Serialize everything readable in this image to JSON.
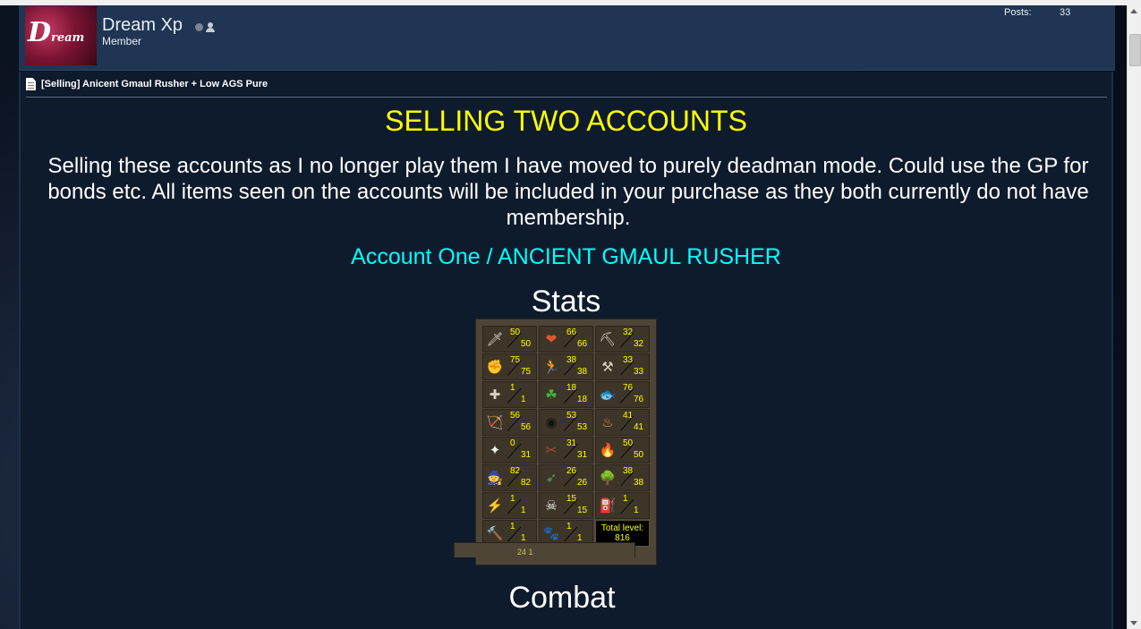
{
  "user": {
    "name": "Dream Xp",
    "title": "Member",
    "posts_label": "Posts:",
    "posts_count": "33",
    "avatar_text_big": "D",
    "avatar_text_small": "ream"
  },
  "post": {
    "title": "[Selling] Anicent Gmaul Rusher + Low AGS Pure",
    "heading": "SELLING TWO ACCOUNTS",
    "intro": "Selling these accounts as I no longer play them I have moved to purely deadman mode. Could use the GP for bonds etc. All items seen on the accounts will be included in your purchase as they both currently do not have membership.",
    "account_heading": "Account One / ANCIENT GMAUL RUSHER",
    "stats_heading": "Stats",
    "combat_heading": "Combat"
  },
  "stats": {
    "skills": [
      {
        "icon": "attack-icon",
        "glyph": "🗡",
        "level": "50",
        "max": "50"
      },
      {
        "icon": "hitpoints-icon",
        "glyph": "❤",
        "level": "66",
        "max": "66"
      },
      {
        "icon": "mining-icon",
        "glyph": "⛏",
        "level": "32",
        "max": "32"
      },
      {
        "icon": "strength-icon",
        "glyph": "✊",
        "level": "75",
        "max": "75"
      },
      {
        "icon": "agility-icon",
        "glyph": "🏃",
        "level": "38",
        "max": "38"
      },
      {
        "icon": "smithing-icon",
        "glyph": "⚒",
        "level": "33",
        "max": "33"
      },
      {
        "icon": "defence-icon",
        "glyph": "✚",
        "level": "1",
        "max": "1"
      },
      {
        "icon": "herblore-icon",
        "glyph": "☘",
        "level": "18",
        "max": "18"
      },
      {
        "icon": "fishing-icon",
        "glyph": "🐟",
        "level": "76",
        "max": "76"
      },
      {
        "icon": "ranged-icon",
        "glyph": "🏹",
        "level": "56",
        "max": "56"
      },
      {
        "icon": "thieving-icon",
        "glyph": "◉",
        "level": "53",
        "max": "53"
      },
      {
        "icon": "cooking-icon",
        "glyph": "♨",
        "level": "41",
        "max": "41"
      },
      {
        "icon": "prayer-icon",
        "glyph": "✦",
        "level": "0",
        "max": "31"
      },
      {
        "icon": "crafting-icon",
        "glyph": "✂",
        "level": "31",
        "max": "31"
      },
      {
        "icon": "firemaking-icon",
        "glyph": "🔥",
        "level": "50",
        "max": "50"
      },
      {
        "icon": "magic-icon",
        "glyph": "🧙",
        "level": "82",
        "max": "82"
      },
      {
        "icon": "fletching-icon",
        "glyph": "➶",
        "level": "26",
        "max": "26"
      },
      {
        "icon": "woodcutting-icon",
        "glyph": "🌳",
        "level": "38",
        "max": "38"
      },
      {
        "icon": "runecraft-icon",
        "glyph": "⚡",
        "level": "1",
        "max": "1"
      },
      {
        "icon": "slayer-icon",
        "glyph": "☠",
        "level": "15",
        "max": "15"
      },
      {
        "icon": "farming-icon",
        "glyph": "⛽",
        "level": "1",
        "max": "1"
      },
      {
        "icon": "construction-icon",
        "glyph": "🔨",
        "level": "1",
        "max": "1"
      },
      {
        "icon": "hunter-icon",
        "glyph": "🐾",
        "level": "1",
        "max": "1"
      }
    ],
    "total_label": "Total level:",
    "total_value": "816"
  },
  "combat": {
    "peek_text": "24 1"
  },
  "colors": {
    "heading": "#ffff00",
    "account_heading": "#00ffff",
    "body_text": "#ffffff",
    "panel_bg": "#0e1b2d",
    "userbar_bg": "#1f3553"
  }
}
